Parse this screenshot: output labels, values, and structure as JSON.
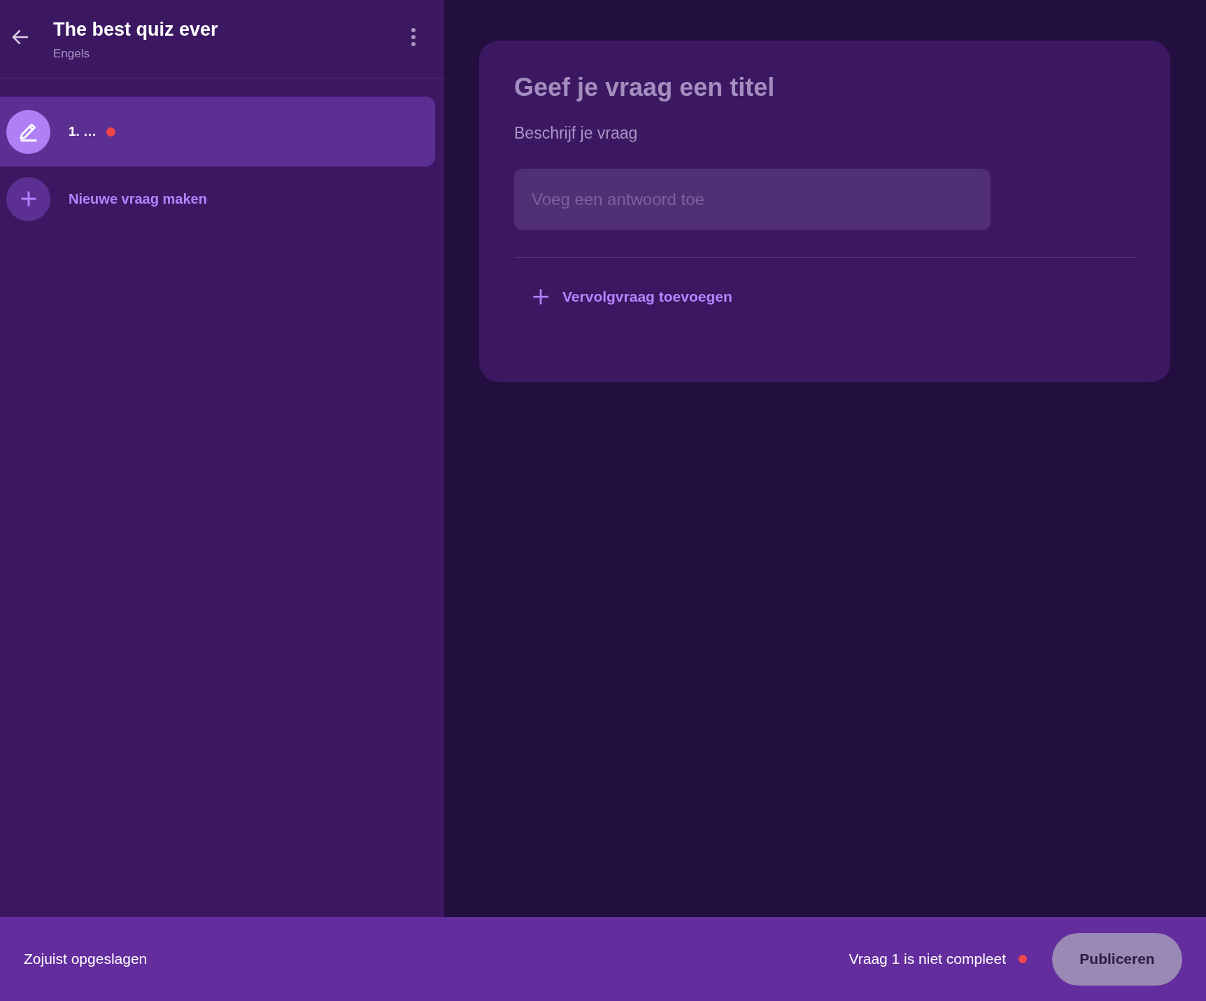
{
  "sidebar": {
    "title": "The best quiz ever",
    "subtitle": "Engels",
    "questions": [
      {
        "label": "1. …",
        "selected": true,
        "complete": false
      }
    ],
    "new_question": "Nieuwe vraag maken"
  },
  "editor": {
    "title_field": {
      "placeholder": "Geef je vraag een titel"
    },
    "description_field": {
      "placeholder": "Beschrijf je vraag"
    },
    "answer_field": {
      "placeholder": "Voeg een antwoord toe"
    },
    "follow_up": "Vervolgvraag toevoegen"
  },
  "status_bar": {
    "saved": "Zojuist opgeslagen",
    "warning": "Vraag 1 is niet compleet",
    "warning_shown": true,
    "publish": {
      "label": "Publiceren",
      "disabled": true
    }
  }
}
